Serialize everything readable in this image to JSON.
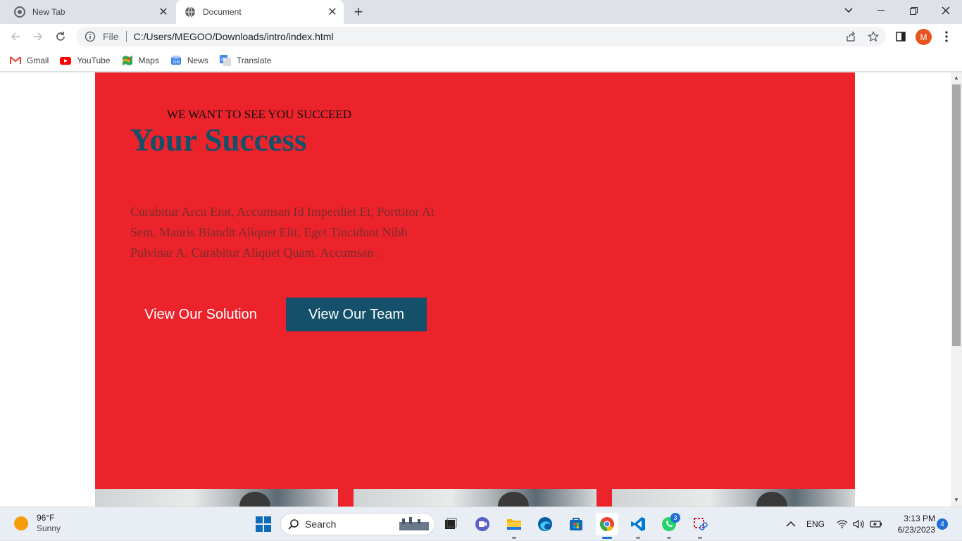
{
  "browser": {
    "tabs": [
      {
        "title": "New Tab",
        "active": false,
        "icon": "chrome-icon"
      },
      {
        "title": "Document",
        "active": true,
        "icon": "globe-icon"
      }
    ],
    "address": {
      "scheme_label": "File",
      "url": "C:/Users/MEGOO/Downloads/intro/index.html"
    },
    "profile_initial": "M",
    "bookmarks": [
      {
        "label": "Gmail",
        "icon": "gmail-icon"
      },
      {
        "label": "YouTube",
        "icon": "youtube-icon"
      },
      {
        "label": "Maps",
        "icon": "maps-icon"
      },
      {
        "label": "News",
        "icon": "news-icon"
      },
      {
        "label": "Translate",
        "icon": "translate-icon"
      }
    ]
  },
  "page": {
    "eyebrow": "WE WANT TO SEE YOU SUCCEED",
    "headline": "Your Success",
    "paragraph": "Curabitur Arcu Erat, Accumsan Id Imperdiet Et, Porttitor At Sem. Mauris Blandit Aliquet Elit, Eget Tincidunt Nibh Pulvinar A. Curabitur Aliquet Quam. Accumsan .",
    "primary_button": "View Our Solution",
    "secondary_button": "View Our Team",
    "colors": {
      "hero_bg": "#ec232b",
      "accent": "#14506a"
    }
  },
  "taskbar": {
    "weather": {
      "temp": "96°F",
      "condition": "Sunny"
    },
    "search_label": "Search",
    "language": "ENG",
    "time": "3:13 PM",
    "date": "6/23/2023",
    "notifications": "4",
    "whatsapp_badge": "3"
  }
}
